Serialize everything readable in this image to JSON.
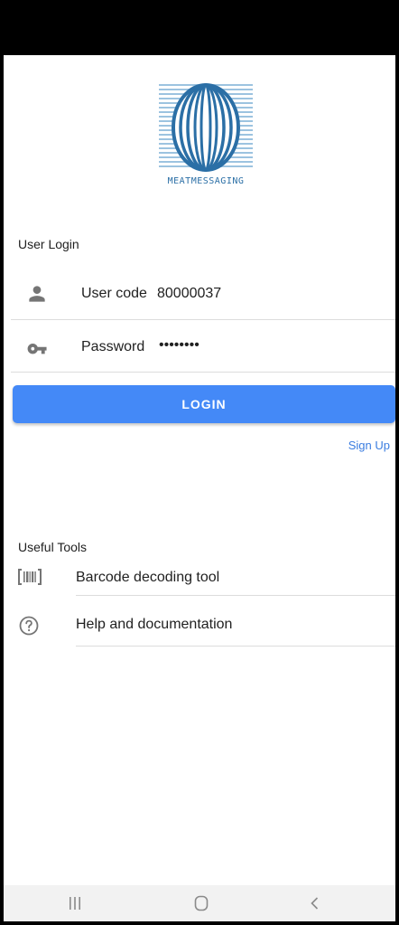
{
  "brand": {
    "logo_text": "MEATMESSAGING"
  },
  "login": {
    "section_title": "User Login",
    "user_code_label": "User code",
    "user_code_value": "80000037",
    "password_label": "Password",
    "password_value": "••••••••",
    "login_button": "LOGIN",
    "signup_link": "Sign Up"
  },
  "tools": {
    "section_title": "Useful Tools",
    "items": [
      {
        "label": "Barcode decoding tool",
        "icon": "barcode-icon"
      },
      {
        "label": "Help and documentation",
        "icon": "help-circle-icon"
      }
    ]
  },
  "nav": {
    "icons": [
      "recent-apps-icon",
      "home-icon",
      "back-icon"
    ]
  },
  "colors": {
    "primary": "#4489f7",
    "link": "#3b7de0",
    "logo": "#2b6fa6",
    "icon": "#757575"
  }
}
